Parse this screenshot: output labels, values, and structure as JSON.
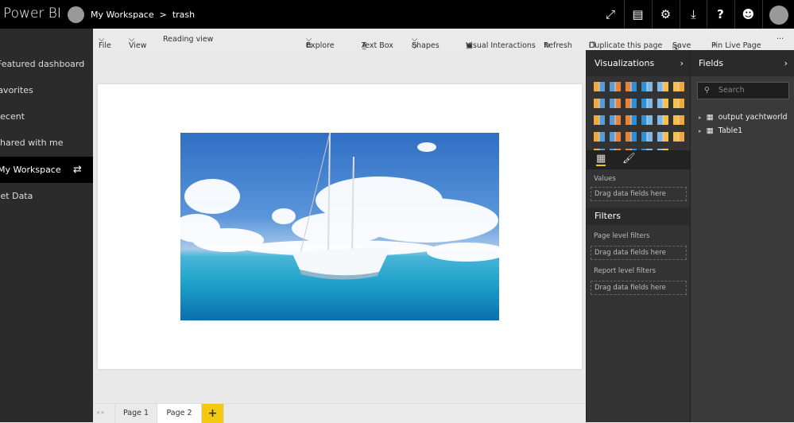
{
  "header": {
    "app_title": "Power BI",
    "breadcrumb_workspace": "My Workspace",
    "breadcrumb_separator": ">",
    "breadcrumb_report": "trash",
    "icons": [
      "fullscreen-icon",
      "comment-icon",
      "gear-icon",
      "download-icon",
      "help-icon",
      "smiley-icon",
      "user-avatar-icon"
    ]
  },
  "nav": {
    "items": [
      {
        "label": "Featured dashboard",
        "more": "···"
      },
      {
        "label": "Favorites"
      },
      {
        "label": "Recent"
      },
      {
        "label": "Shared with me"
      },
      {
        "label": "My Workspace",
        "selected": true
      },
      {
        "label": "Get Data"
      }
    ]
  },
  "toolbar": {
    "file": "File",
    "view": "View",
    "reading_view": "Reading view",
    "explore": "Explore",
    "text_box": "Text Box",
    "shapes": "Shapes",
    "visual_interactions": "Visual Interactions",
    "refresh": "Refresh",
    "duplicate": "Duplicate this page",
    "save": "Save",
    "pin_live": "Pin Live Page",
    "more": "···"
  },
  "page_tabs": {
    "tabs": [
      "Page 1",
      "Page 2"
    ],
    "active": "Page 2",
    "add": "+"
  },
  "visualizations": {
    "title": "Visualizations",
    "values_label": "Values",
    "drag_hint": "Drag data fields here",
    "more": "···",
    "colors": [
      "#f2a93b",
      "#5b9bd5",
      "#e8843a",
      "#2e8fd6",
      "#7fb8e6",
      "#f7c04a"
    ]
  },
  "filters": {
    "title": "Filters",
    "page_level": "Page level filters",
    "report_level": "Report level filters",
    "drag_hint": "Drag data fields here"
  },
  "fields": {
    "title": "Fields",
    "search_placeholder": "Search",
    "tables": [
      "output yachtworld",
      "Table1"
    ]
  },
  "accent": "#f2c811"
}
